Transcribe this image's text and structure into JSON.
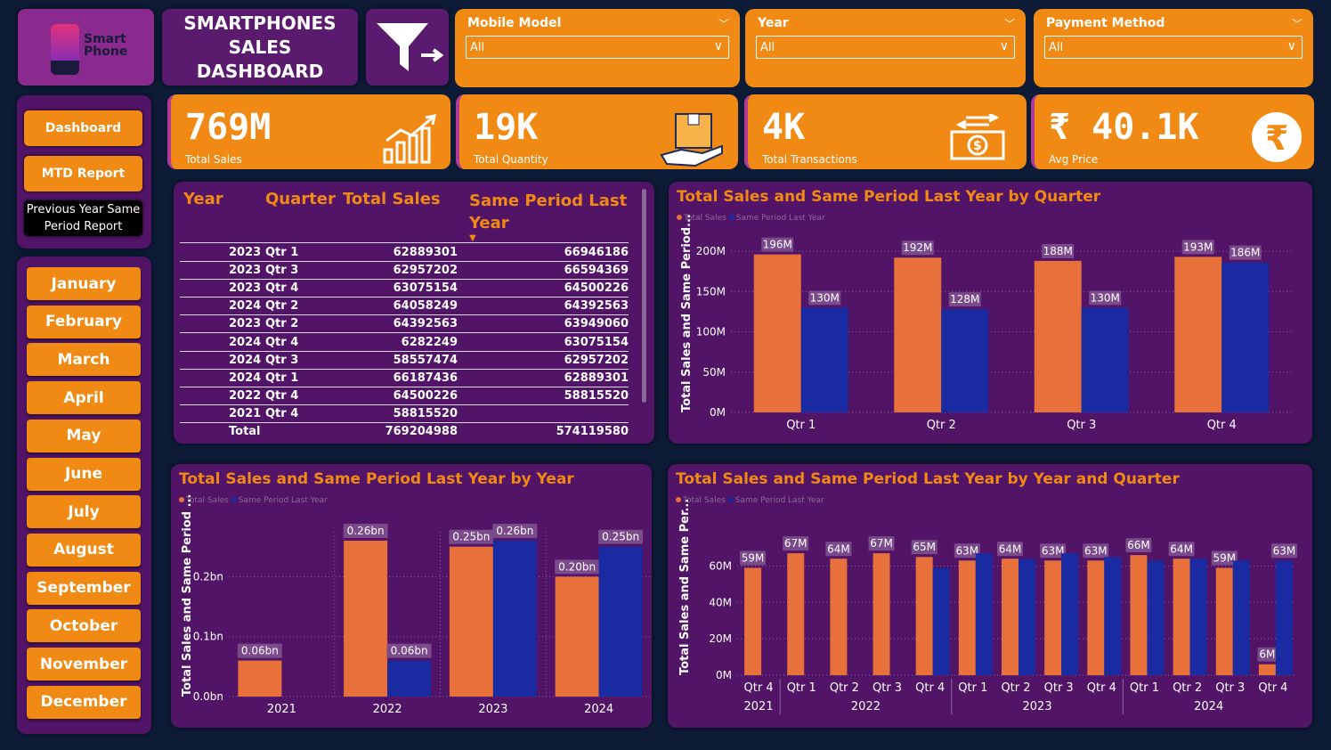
{
  "logo": {
    "line1": "Smart",
    "line2": "Phone"
  },
  "header": {
    "title_l1": "SMARTPHONES",
    "title_l2": "SALES",
    "title_l3": "DASHBOARD"
  },
  "slicers": [
    {
      "label": "Mobile Model",
      "value": "All"
    },
    {
      "label": "Year",
      "value": "All"
    },
    {
      "label": "Payment Method",
      "value": "All"
    }
  ],
  "kpis": [
    {
      "value": "769M",
      "caption": "Total Sales",
      "icon": "bar-growth-icon"
    },
    {
      "value": "19K",
      "caption": "Total Quantity",
      "icon": "package-hand-icon"
    },
    {
      "value": "4K",
      "caption": "Total Transactions",
      "icon": "money-transfer-icon"
    },
    {
      "value": "₹ 40.1K",
      "caption": "Avg Price",
      "icon": "rupee-icon"
    }
  ],
  "nav": {
    "dashboard": "Dashboard",
    "mtd": "MTD Report",
    "pysp_l1": "Previous Year Same",
    "pysp_l2": "Period Report"
  },
  "months": [
    "January",
    "February",
    "March",
    "April",
    "May",
    "June",
    "July",
    "August",
    "September",
    "October",
    "November",
    "December"
  ],
  "table": {
    "headers": {
      "year": "Year",
      "quarter": "Quarter",
      "sales": "Total Sales",
      "spl_l1": "Same Period Last",
      "spl_l2": "Year"
    },
    "rows": [
      [
        "2023",
        "Qtr 1",
        "62889301",
        "66946186"
      ],
      [
        "2023",
        "Qtr 3",
        "62957202",
        "66594369"
      ],
      [
        "2023",
        "Qtr 4",
        "63075154",
        "64500226"
      ],
      [
        "2024",
        "Qtr 2",
        "64058249",
        "64392563"
      ],
      [
        "2023",
        "Qtr 2",
        "64392563",
        "63949060"
      ],
      [
        "2024",
        "Qtr 4",
        "6282249",
        "63075154"
      ],
      [
        "2024",
        "Qtr 3",
        "58557474",
        "62957202"
      ],
      [
        "2024",
        "Qtr 1",
        "66187436",
        "62889301"
      ],
      [
        "2022",
        "Qtr 4",
        "64500226",
        "58815520"
      ],
      [
        "2021",
        "Qtr 4",
        "58815520",
        ""
      ]
    ],
    "total": {
      "label": "Total",
      "sales": "769204988",
      "spl": "574119580"
    }
  },
  "colors": {
    "total_sales": "#e8703a",
    "same_period": "#1a2aa0",
    "accent": "#f08a14",
    "panel": "#521466"
  },
  "legend": {
    "a": "Total Sales",
    "b": "Same Period Last Year"
  },
  "chart_data": [
    {
      "type": "bar",
      "title": "Total Sales and Same Period Last Year by Quarter",
      "ylabel": "Total Sales and Same Period...",
      "categories": [
        "Qtr 1",
        "Qtr 2",
        "Qtr 3",
        "Qtr 4"
      ],
      "yticks": [
        "0M",
        "50M",
        "100M",
        "150M",
        "200M"
      ],
      "ylim": [
        0,
        200
      ],
      "series": [
        {
          "name": "Total Sales",
          "values": [
            196,
            192,
            188,
            193
          ],
          "labels": [
            "196M",
            "192M",
            "188M",
            "193M"
          ]
        },
        {
          "name": "Same Period Last Year",
          "values": [
            130,
            128,
            130,
            186
          ],
          "labels": [
            "130M",
            "128M",
            "130M",
            "186M"
          ]
        }
      ]
    },
    {
      "type": "bar",
      "title": "Total Sales and Same Period Last Year by Year",
      "ylabel": "Total Sales and Same Period ...",
      "categories": [
        "2021",
        "2022",
        "2023",
        "2024"
      ],
      "yticks": [
        "0.0bn",
        "0.1bn",
        "0.2bn"
      ],
      "ylim": [
        0,
        0.26
      ],
      "series": [
        {
          "name": "Total Sales",
          "values": [
            0.06,
            0.26,
            0.25,
            0.2
          ],
          "labels": [
            "0.06bn",
            "0.26bn",
            "0.25bn",
            "0.20bn"
          ]
        },
        {
          "name": "Same Period Last Year",
          "values": [
            null,
            0.06,
            0.26,
            0.25
          ],
          "labels": [
            "",
            "0.06bn",
            "0.26bn",
            "0.25bn"
          ]
        }
      ]
    },
    {
      "type": "bar",
      "title": "Total Sales and Same Period Last Year by Year and Quarter",
      "ylabel": "Total Sales and Same Per...",
      "categories": [
        "Qtr 4",
        "Qtr 1",
        "Qtr 2",
        "Qtr 3",
        "Qtr 4",
        "Qtr 1",
        "Qtr 2",
        "Qtr 3",
        "Qtr 4",
        "Qtr 1",
        "Qtr 2",
        "Qtr 3",
        "Qtr 4"
      ],
      "groups": [
        {
          "label": "2021",
          "span": 1
        },
        {
          "label": "2022",
          "span": 4
        },
        {
          "label": "2023",
          "span": 4
        },
        {
          "label": "2024",
          "span": 4
        }
      ],
      "yticks": [
        "0M",
        "20M",
        "40M",
        "60M"
      ],
      "ylim": [
        0,
        70
      ],
      "series": [
        {
          "name": "Total Sales",
          "values": [
            59,
            67,
            64,
            67,
            65,
            63,
            64,
            63,
            63,
            66,
            64,
            59,
            6
          ],
          "labels": [
            "59M",
            "67M",
            "64M",
            "67M",
            "65M",
            "63M",
            "64M",
            "63M",
            "63M",
            "66M",
            "64M",
            "59M",
            "6M"
          ]
        },
        {
          "name": "Same Period Last Year",
          "values": [
            null,
            null,
            null,
            null,
            59,
            67,
            64,
            67,
            65,
            63,
            64,
            63,
            63
          ],
          "labels": [
            "",
            "",
            "",
            "",
            "",
            "",
            "",
            "",
            "",
            "",
            "",
            "",
            "63M"
          ]
        }
      ]
    }
  ]
}
